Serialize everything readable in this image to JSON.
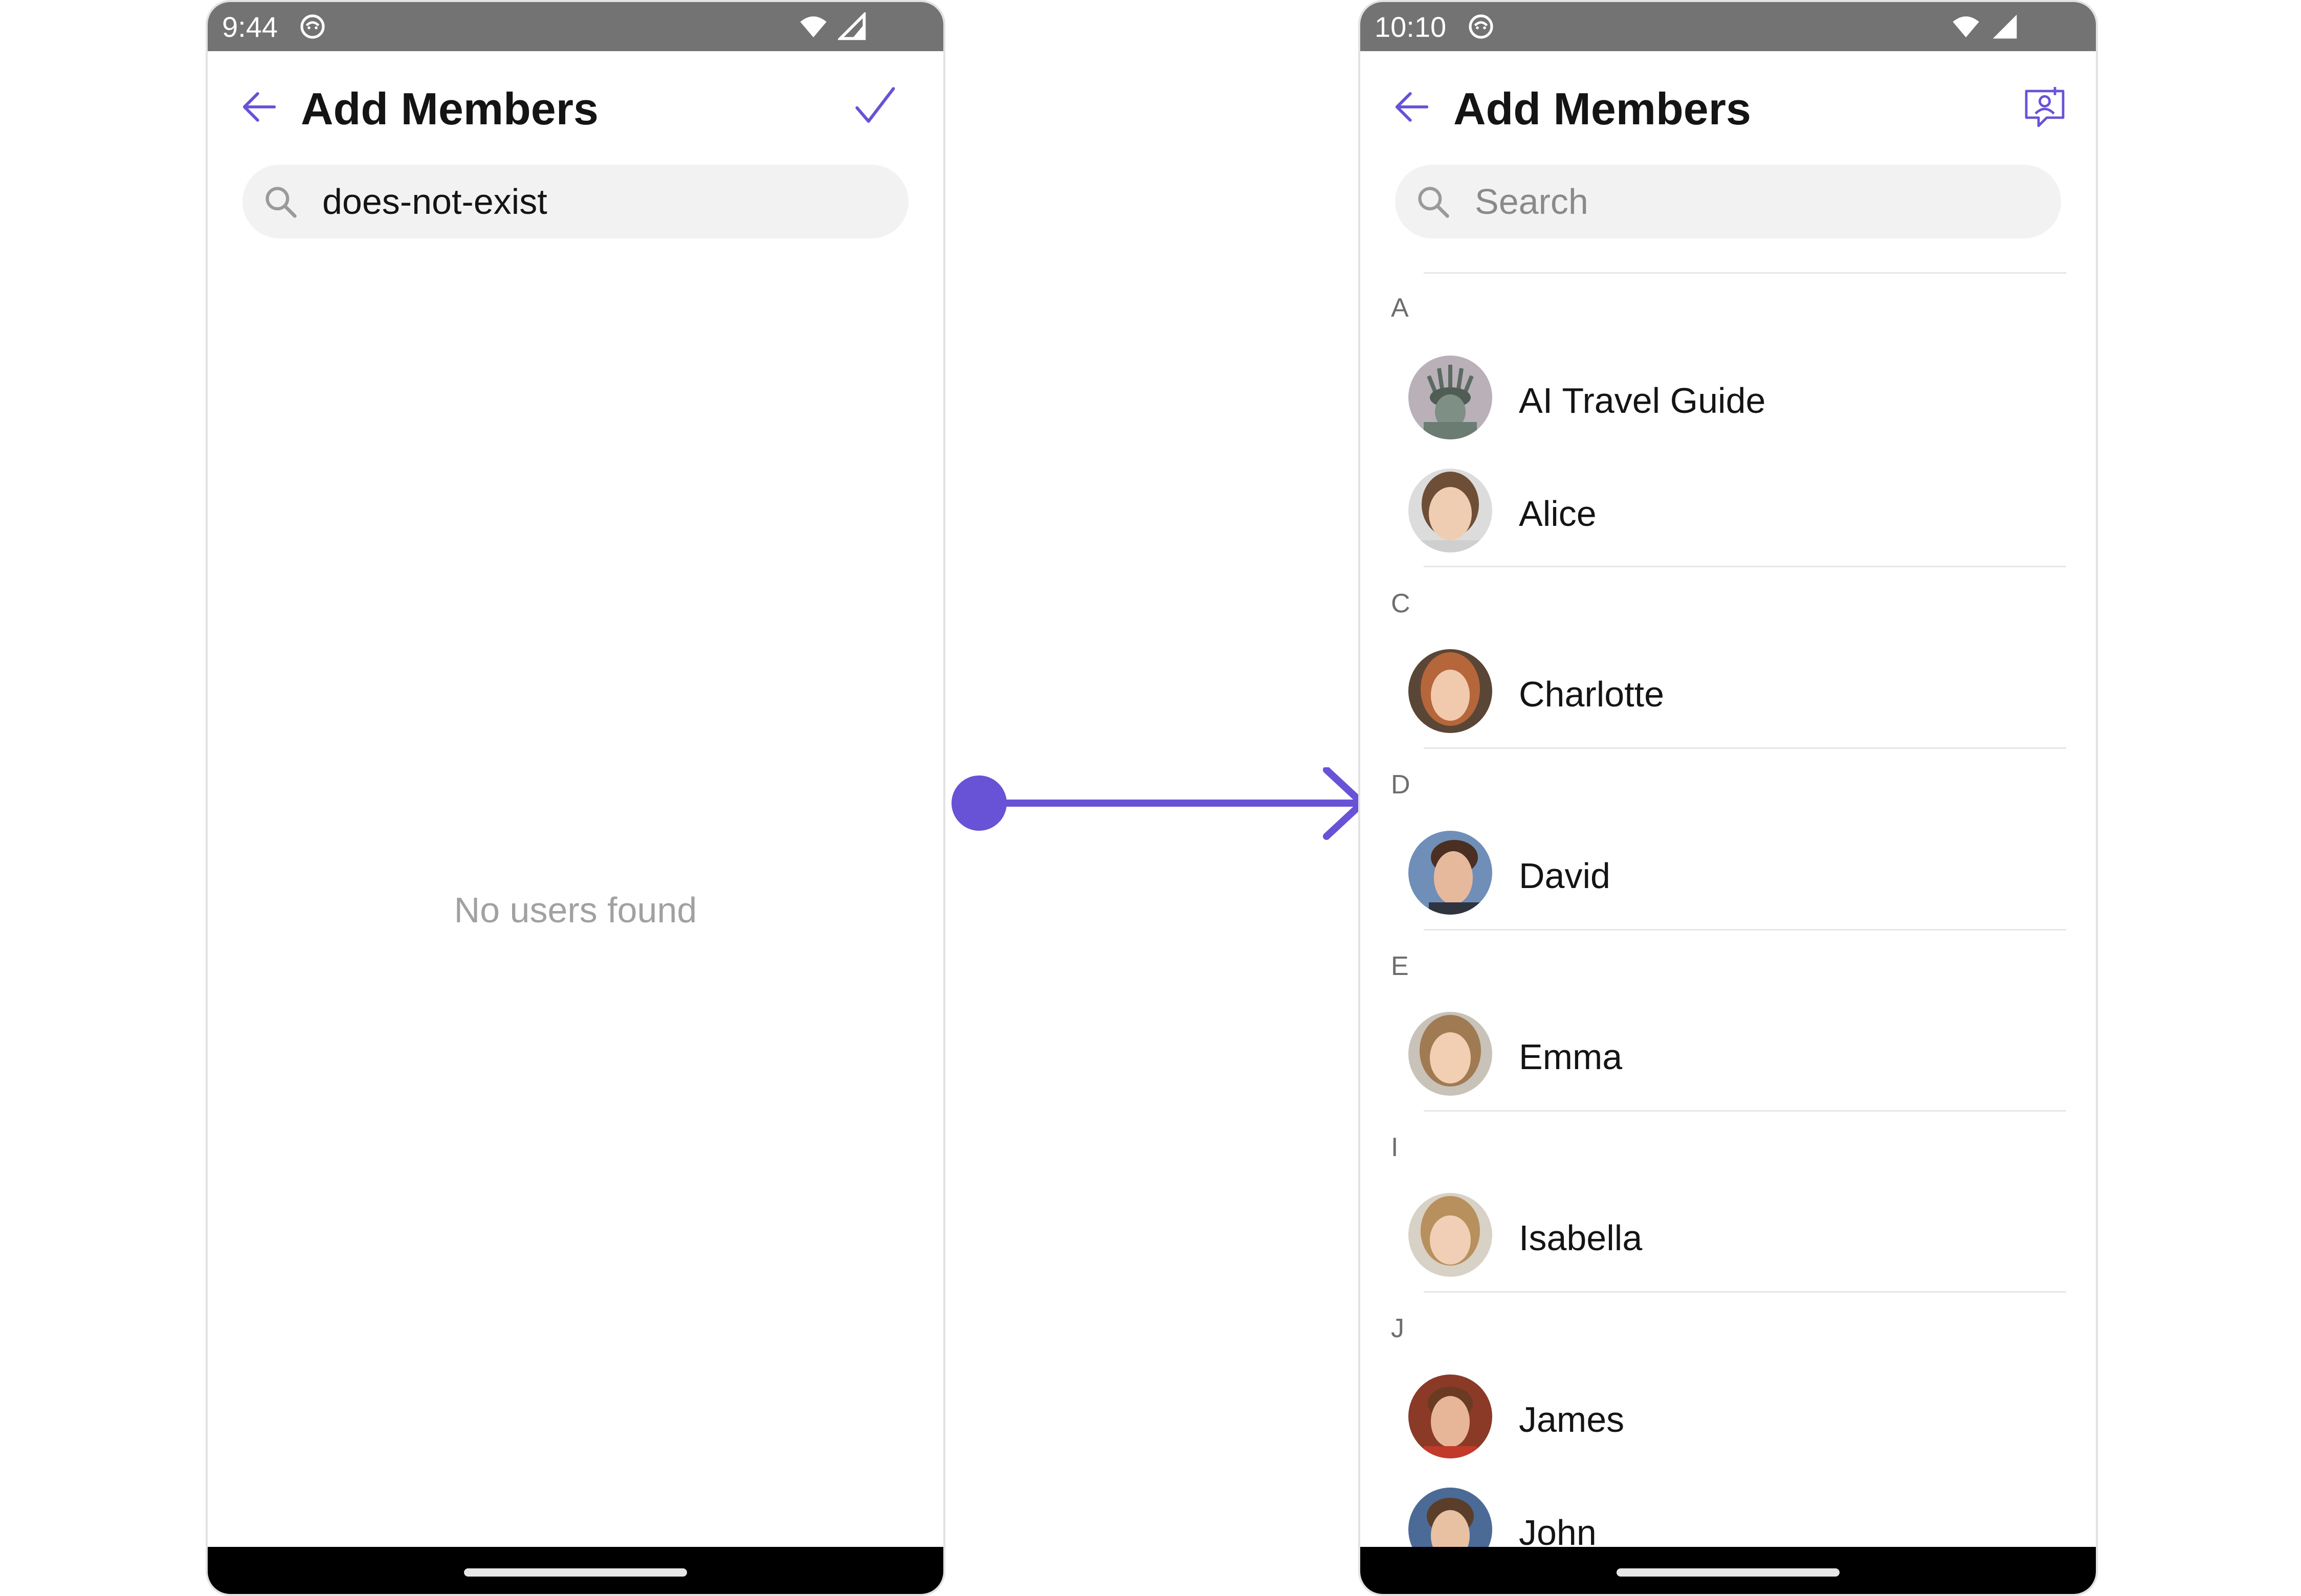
{
  "left_screen": {
    "status": {
      "time": "9:44"
    },
    "header": {
      "title": "Add Members"
    },
    "search": {
      "value": "does-not-exist"
    },
    "empty_message": "No users found"
  },
  "right_screen": {
    "status": {
      "time": "10:10"
    },
    "header": {
      "title": "Add Members"
    },
    "search": {
      "placeholder": "Search"
    },
    "sections": [
      {
        "letter": "A",
        "users": [
          "AI Travel Guide",
          "Alice"
        ]
      },
      {
        "letter": "C",
        "users": [
          "Charlotte"
        ]
      },
      {
        "letter": "D",
        "users": [
          "David"
        ]
      },
      {
        "letter": "E",
        "users": [
          "Emma"
        ]
      },
      {
        "letter": "I",
        "users": [
          "Isabella"
        ]
      },
      {
        "letter": "J",
        "users": [
          "James",
          "John"
        ]
      }
    ]
  },
  "colors": {
    "accent": "#6852d6",
    "status_bar": "#737373",
    "search_bg": "#f2f2f2",
    "divider": "#e6e6e6"
  },
  "icons": {
    "back": "arrow-left-icon",
    "confirm": "checkmark-icon",
    "add_user": "add-user-icon",
    "search": "search-icon",
    "wifi": "wifi-icon",
    "signal": "signal-icon"
  }
}
